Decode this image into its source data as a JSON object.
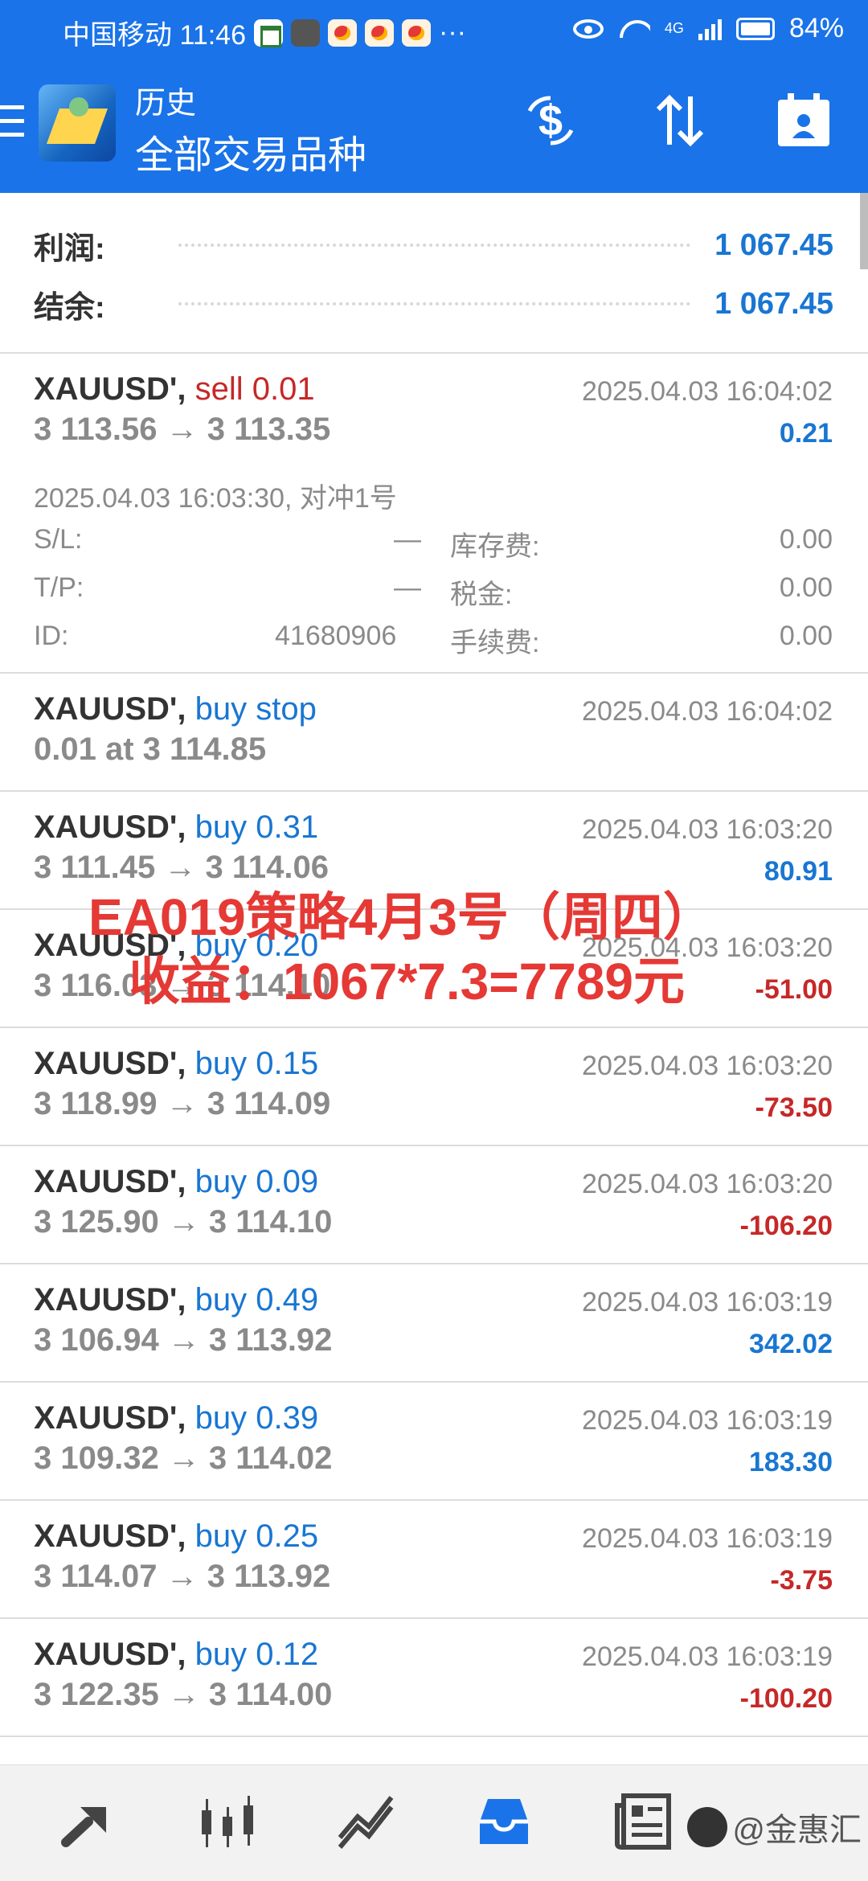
{
  "status_bar": {
    "carrier_time": "中国移动 11:46",
    "more": "···",
    "network": "4G",
    "battery": "84%"
  },
  "header": {
    "title": "历史",
    "subtitle": "全部交易品种"
  },
  "summary": {
    "profit_label": "利润:",
    "profit_value": "1 067.45",
    "balance_label": "结余:",
    "balance_value": "1 067.45"
  },
  "expanded_trade": {
    "symbol": "XAUUSD',",
    "action": "sell 0.01",
    "time": "2025.04.03 16:04:02",
    "prices": "3 113.56 → 3 113.35",
    "profit": "0.21",
    "open_info": "2025.04.03 16:03:30, 对冲1号",
    "sl_label": "S/L:",
    "sl_value": "—",
    "tp_label": "T/P:",
    "tp_value": "—",
    "id_label": "ID:",
    "id_value": "41680906",
    "swap_label": "库存费:",
    "swap_value": "0.00",
    "tax_label": "税金:",
    "tax_value": "0.00",
    "fee_label": "手续费:",
    "fee_value": "0.00"
  },
  "trades": [
    {
      "symbol": "XAUUSD',",
      "action": "buy stop",
      "type": "buy",
      "time": "2025.04.03 16:04:02",
      "prices": "0.01 at 3 114.85",
      "profit": "",
      "sign": "pos"
    },
    {
      "symbol": "XAUUSD',",
      "action": "buy 0.31",
      "type": "buy",
      "time": "2025.04.03 16:03:20",
      "prices": "3 111.45 → 3 114.06",
      "profit": "80.91",
      "sign": "pos"
    },
    {
      "symbol": "XAUUSD',",
      "action": "buy 0.20",
      "type": "buy",
      "time": "2025.04.03 16:03:20",
      "prices": "3 116.03 → 3 114.10",
      "profit": "-51.00",
      "sign": "neg"
    },
    {
      "symbol": "XAUUSD',",
      "action": "buy 0.15",
      "type": "buy",
      "time": "2025.04.03 16:03:20",
      "prices": "3 118.99 → 3 114.09",
      "profit": "-73.50",
      "sign": "neg"
    },
    {
      "symbol": "XAUUSD',",
      "action": "buy 0.09",
      "type": "buy",
      "time": "2025.04.03 16:03:20",
      "prices": "3 125.90 → 3 114.10",
      "profit": "-106.20",
      "sign": "neg"
    },
    {
      "symbol": "XAUUSD',",
      "action": "buy 0.49",
      "type": "buy",
      "time": "2025.04.03 16:03:19",
      "prices": "3 106.94 → 3 113.92",
      "profit": "342.02",
      "sign": "pos"
    },
    {
      "symbol": "XAUUSD',",
      "action": "buy 0.39",
      "type": "buy",
      "time": "2025.04.03 16:03:19",
      "prices": "3 109.32 → 3 114.02",
      "profit": "183.30",
      "sign": "pos"
    },
    {
      "symbol": "XAUUSD',",
      "action": "buy 0.25",
      "type": "buy",
      "time": "2025.04.03 16:03:19",
      "prices": "3 114.07 → 3 113.92",
      "profit": "-3.75",
      "sign": "neg"
    },
    {
      "symbol": "XAUUSD',",
      "action": "buy 0.12",
      "type": "buy",
      "time": "2025.04.03 16:03:19",
      "prices": "3 122.35 → 3 114.00",
      "profit": "-100.20",
      "sign": "neg"
    }
  ],
  "overlay": {
    "line1": "EA019策略4月3号（周四）",
    "line2": "收益：1067*7.3=7789元"
  },
  "bottom_nav": {
    "icons": [
      "quotes-icon",
      "chart-icon",
      "trade-icon",
      "history-icon",
      "news-icon",
      "messages-icon"
    ],
    "watermark": "@金惠汇"
  },
  "colors": {
    "primary": "#1a73e8",
    "profit_positive": "#1976d2",
    "profit_negative": "#c62828",
    "overlay_text": "#e53935"
  }
}
